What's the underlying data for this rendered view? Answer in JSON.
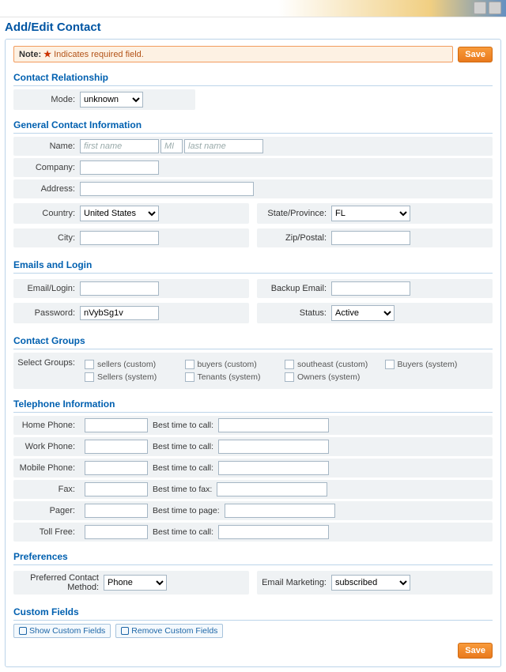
{
  "page_title": "Add/Edit Contact",
  "note": {
    "prefix": "Note:",
    "text": "Indicates required field."
  },
  "save_label": "Save",
  "sections": {
    "relationship": "Contact Relationship",
    "general": "General Contact Information",
    "emails": "Emails and Login",
    "groups": "Contact Groups",
    "telephone": "Telephone Information",
    "preferences": "Preferences",
    "custom": "Custom Fields"
  },
  "labels": {
    "mode": "Mode:",
    "name": "Name:",
    "company": "Company:",
    "address": "Address:",
    "country": "Country:",
    "state": "State/Province:",
    "city": "City:",
    "zip": "Zip/Postal:",
    "email_login": "Email/Login:",
    "backup_email": "Backup Email:",
    "password": "Password:",
    "status": "Status:",
    "select_groups": "Select Groups:",
    "home_phone": "Home Phone:",
    "work_phone": "Work Phone:",
    "mobile_phone": "Mobile Phone:",
    "fax": "Fax:",
    "pager": "Pager:",
    "toll_free": "Toll Free:",
    "best_call": "Best time to call:",
    "best_fax": "Best time to fax:",
    "best_page": "Best time to page:",
    "pref_method": "Preferred Contact Method:",
    "email_marketing": "Email Marketing:"
  },
  "placeholders": {
    "first_name": "first name",
    "mi": "MI",
    "last_name": "last name"
  },
  "values": {
    "mode": "unknown",
    "country": "United States",
    "state": "FL",
    "password": "nVybSg1v",
    "status": "Active",
    "pref_method": "Phone",
    "email_marketing": "subscribed"
  },
  "groups": [
    "sellers (custom)",
    "buyers (custom)",
    "southeast (custom)",
    "Buyers (system)",
    "Sellers (system)",
    "Tenants (system)",
    "Owners (system)"
  ],
  "custom_buttons": {
    "show": "Show Custom Fields",
    "remove": "Remove Custom Fields"
  }
}
